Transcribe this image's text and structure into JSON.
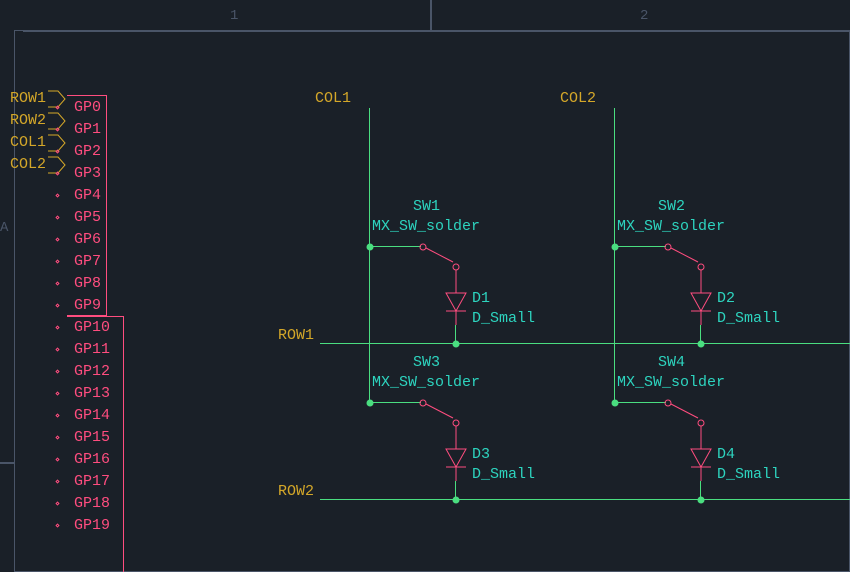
{
  "grid": {
    "col1": "1",
    "col2": "2",
    "rowA": "A"
  },
  "netlabels": {
    "row1_pin": "ROW1",
    "row2_pin": "ROW2",
    "col1_pin": "COL1",
    "col2_pin": "COL2",
    "col1": "COL1",
    "col2": "COL2",
    "row1": "ROW1",
    "row2": "ROW2"
  },
  "pins": {
    "gp0": "GP0",
    "gp1": "GP1",
    "gp2": "GP2",
    "gp3": "GP3",
    "gp4": "GP4",
    "gp5": "GP5",
    "gp6": "GP6",
    "gp7": "GP7",
    "gp8": "GP8",
    "gp9": "GP9",
    "gp10": "GP10",
    "gp11": "GP11",
    "gp12": "GP12",
    "gp13": "GP13",
    "gp14": "GP14",
    "gp15": "GP15",
    "gp16": "GP16",
    "gp17": "GP17",
    "gp18": "GP18",
    "gp19": "GP19"
  },
  "switches": {
    "sw1": {
      "ref": "SW1",
      "value": "MX_SW_solder"
    },
    "sw2": {
      "ref": "SW2",
      "value": "MX_SW_solder"
    },
    "sw3": {
      "ref": "SW3",
      "value": "MX_SW_solder"
    },
    "sw4": {
      "ref": "SW4",
      "value": "MX_SW_solder"
    }
  },
  "diodes": {
    "d1": {
      "ref": "D1",
      "value": "D_Small"
    },
    "d2": {
      "ref": "D2",
      "value": "D_Small"
    },
    "d3": {
      "ref": "D3",
      "value": "D_Small"
    },
    "d4": {
      "ref": "D4",
      "value": "D_Small"
    }
  }
}
